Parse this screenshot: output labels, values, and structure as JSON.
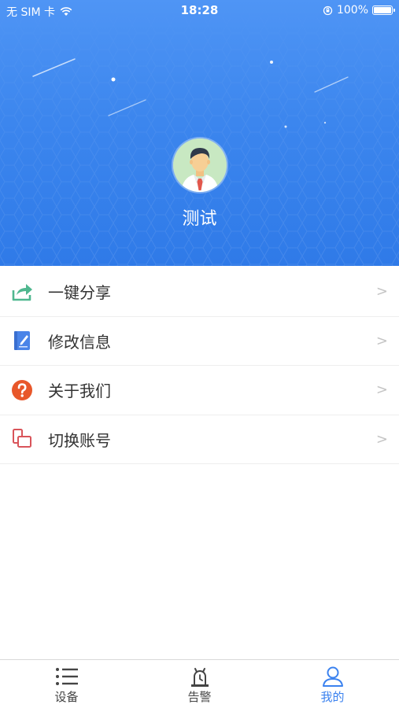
{
  "status_bar": {
    "carrier": "无 SIM 卡",
    "time": "18:28",
    "battery": "100%"
  },
  "profile": {
    "name": "测试"
  },
  "menu": {
    "items": [
      {
        "label": "一键分享",
        "arrow": ">",
        "icon": "share-icon",
        "color": "#4fb78f"
      },
      {
        "label": "修改信息",
        "arrow": ">",
        "icon": "edit-document-icon",
        "color": "#4a84e8"
      },
      {
        "label": "关于我们",
        "arrow": ">",
        "icon": "question-icon",
        "color": "#e8572a"
      },
      {
        "label": "切换账号",
        "arrow": ">",
        "icon": "switch-account-icon",
        "color": "#d9545a"
      }
    ]
  },
  "tabbar": {
    "tabs": [
      {
        "label": "设备",
        "icon": "list-icon",
        "active": false
      },
      {
        "label": "告警",
        "icon": "alarm-icon",
        "active": false
      },
      {
        "label": "我的",
        "icon": "user-icon",
        "active": true
      }
    ],
    "active_color": "#3b82ef"
  },
  "colors": {
    "header_blue": "#3c86ee",
    "text": "#333333"
  }
}
